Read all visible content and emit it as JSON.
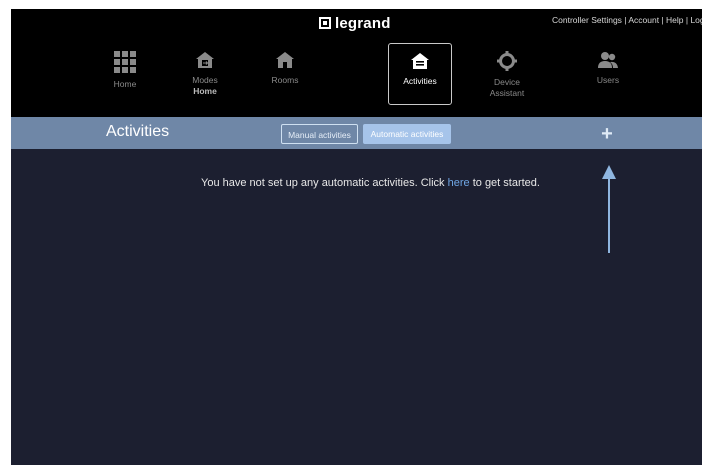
{
  "header": {
    "brand": "legrand",
    "links": "Controller Settings | Account | Help | Logout"
  },
  "nav": {
    "items": [
      {
        "label": "Home",
        "icon": "grid-icon"
      },
      {
        "label": "Modes",
        "sub": "Home",
        "icon": "house-exit-icon"
      },
      {
        "label": "Rooms",
        "icon": "house-icon"
      },
      {
        "label": "Activities",
        "icon": "house-list-icon",
        "active": true
      },
      {
        "label": "Device",
        "sub": "Assistant",
        "icon": "gear-icon"
      },
      {
        "label": "Users",
        "icon": "users-icon"
      }
    ]
  },
  "toolbar": {
    "title": "Activities",
    "tabs": [
      {
        "label": "Manual activities",
        "selected": false
      },
      {
        "label": "Automatic activities",
        "selected": true
      }
    ],
    "add_icon": "plus-icon"
  },
  "main": {
    "message_before": "You have not set up any automatic activities. Click ",
    "message_link": "here",
    "message_after": " to get started."
  },
  "colors": {
    "background": "#000000",
    "toolbar": "#6f87a7",
    "content": "#1c1f30",
    "accent": "#a6c4ea",
    "link": "#6fa6e4"
  }
}
